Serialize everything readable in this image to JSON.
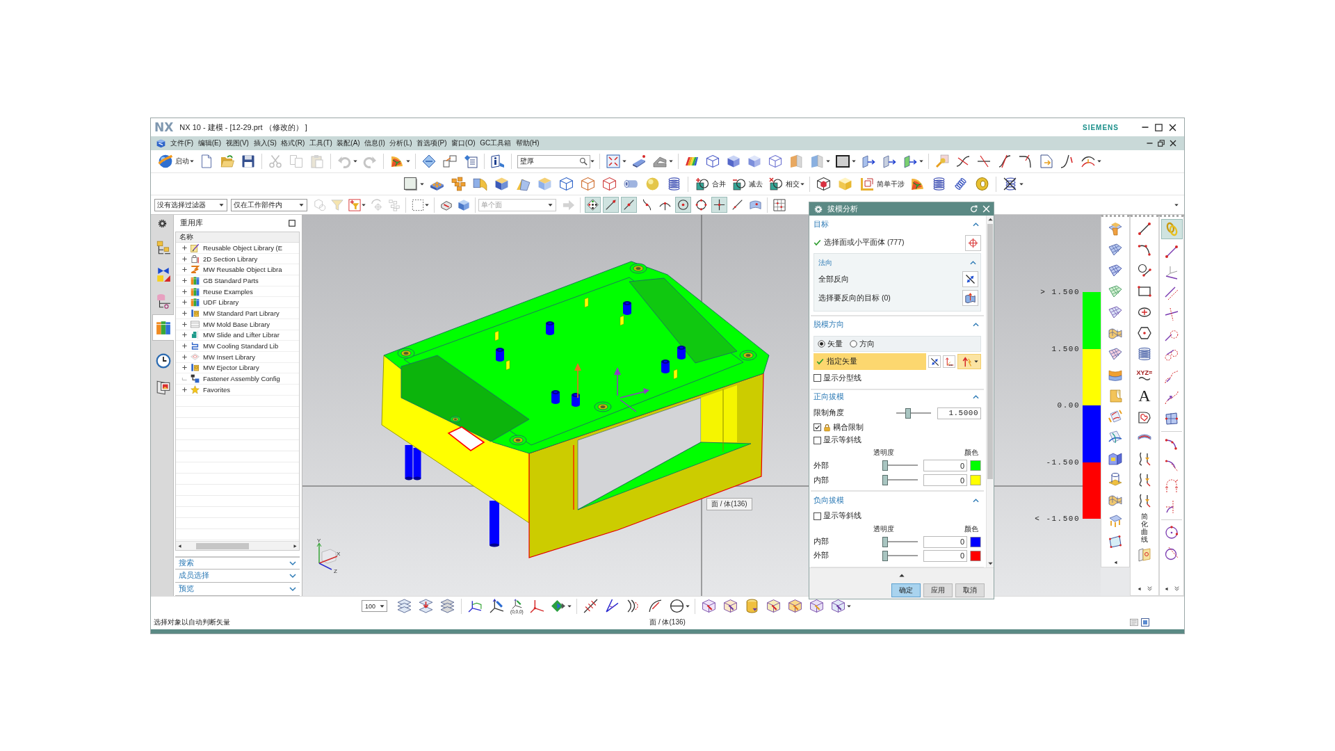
{
  "title_bar": {
    "logo": "NX",
    "title": "NX 10 - 建模 - [12-29.prt （修改的） ]",
    "brand": "SIEMENS"
  },
  "menu_bar": {
    "items": [
      "文件(F)",
      "编辑(E)",
      "视图(V)",
      "插入(S)",
      "格式(R)",
      "工具(T)",
      "装配(A)",
      "信息(I)",
      "分析(L)",
      "首选项(P)",
      "窗口(O)",
      "GC工具箱",
      "帮助(H)"
    ]
  },
  "standard_toolbar": {
    "start_button": "启动",
    "edit_tools": [
      {
        "disabled": true
      },
      {
        "disabled": true
      },
      {
        "disabled": true
      },
      {
        "disabled": true
      },
      {
        "disabled": true
      }
    ],
    "search": {
      "value": "壁厚"
    }
  },
  "feature_toolbar": {
    "labeled_buttons": [
      "合并",
      "减去",
      "相交",
      "简单干涉"
    ]
  },
  "selection_bar": {
    "type_filter": "没有选择过滤器",
    "scope": "仅在工作部件内",
    "tools": [
      {
        "disabled": true
      },
      {
        "disabled": true
      },
      {
        "disabled": false
      },
      {
        "disabled": true
      },
      {
        "disabled": true
      }
    ],
    "face_rule": {
      "value": "单个面",
      "disabled": true
    },
    "snap_points": [
      {
        "on": true
      },
      {
        "on": true
      },
      {
        "on": true
      },
      {
        "on": false
      },
      {
        "on": false
      },
      {
        "on": true
      },
      {
        "on": false
      },
      {
        "on": true
      },
      {
        "on": false
      },
      {
        "on": false
      }
    ]
  },
  "resource_bar": {
    "tabs": [
      {
        "selected": false
      },
      {
        "selected": false
      },
      {
        "selected": false
      },
      {
        "selected": true
      },
      {
        "selected": false
      },
      {
        "selected": false
      }
    ]
  },
  "reuse_library": {
    "title": "重用库",
    "column": "名称",
    "items": [
      {
        "label": "Reusable Object Library (E",
        "expandable": true
      },
      {
        "label": "2D Section Library",
        "expandable": true
      },
      {
        "label": "MW Reusable Object Libra",
        "expandable": true
      },
      {
        "label": "GB Standard Parts",
        "expandable": true
      },
      {
        "label": "Reuse Examples",
        "expandable": true
      },
      {
        "label": "UDF Library",
        "expandable": true
      },
      {
        "label": "MW Standard Part Library",
        "expandable": true
      },
      {
        "label": "MW Mold Base Library",
        "expandable": true
      },
      {
        "label": "MW Slide and Lifter Librar",
        "expandable": true
      },
      {
        "label": "MW Cooling Standard Lib",
        "expandable": true
      },
      {
        "label": "MW Insert Library",
        "expandable": true
      },
      {
        "label": "MW Ejector Library",
        "expandable": true
      },
      {
        "label": "Fastener Assembly Config",
        "expandable": false
      },
      {
        "label": "Favorites",
        "expandable": true
      }
    ],
    "sections": [
      {
        "label": "搜索",
        "expanded": false
      },
      {
        "label": "成员选择",
        "expanded": false
      },
      {
        "label": "预览",
        "expanded": false
      }
    ]
  },
  "viewport": {
    "tooltip": "面 / 体(136)",
    "axis_labels": [
      "Y",
      "X",
      "Z"
    ],
    "legend": {
      "labels": [
        "> 1.500",
        "1.500",
        "0.00",
        "-1.500",
        "< -1.500"
      ],
      "bands": [
        {
          "color": "#00ff00"
        },
        {
          "color": "#ffff00"
        },
        {
          "color": "#0000ff"
        },
        {
          "color": "#ff0000"
        }
      ]
    }
  },
  "draft_dialog": {
    "title": "拔模分析",
    "target": {
      "title": "目标",
      "expanded": true,
      "selection": {
        "label": "选择面或小平面体 (777)",
        "done": true
      },
      "normal": {
        "title": "法向",
        "expanded": true,
        "actions": [
          "全部反向",
          "选择要反向的目标 (0)"
        ]
      }
    },
    "draw_direction": {
      "title": "脱模方向",
      "expanded": true,
      "options": [
        {
          "label": "矢量",
          "selected": true
        },
        {
          "label": "方向",
          "selected": false
        }
      ],
      "vector": {
        "label": "指定矢量",
        "done": true
      },
      "parting_line": {
        "label": "显示分型线",
        "checked": false
      }
    },
    "positive_draft": {
      "title": "正向拔模",
      "expanded": true,
      "limit_angle": {
        "label": "限制角度",
        "level": 0.32,
        "value": "1.5000"
      },
      "coupled_limit": {
        "label": "耦合限制",
        "checked": true
      },
      "isoclines": {
        "label": "显示等斜线",
        "checked": false
      },
      "columns": [
        "透明度",
        "颜色"
      ],
      "rows": [
        {
          "label": "外部",
          "level": 0,
          "value": "0",
          "color": "#00ff00"
        },
        {
          "label": "内部",
          "level": 0,
          "value": "0",
          "color": "#ffff00"
        }
      ]
    },
    "negative_draft": {
      "title": "负向拔模",
      "expanded": true,
      "isoclines": {
        "label": "显示等斜线",
        "checked": false
      },
      "columns": [
        "透明度",
        "颜色"
      ],
      "rows": [
        {
          "label": "内部",
          "level": 0,
          "value": "0",
          "color": "#0000ff"
        },
        {
          "label": "外部",
          "level": 0,
          "value": "0",
          "color": "#ff0000"
        }
      ]
    },
    "buttons": [
      {
        "label": "确定",
        "default": true
      },
      {
        "label": "应用",
        "default": false
      },
      {
        "label": "取消",
        "default": false
      }
    ]
  },
  "side_toolbars": {
    "formula_label": "XYZ=",
    "text_label": "A",
    "vertical_label": "简化曲线",
    "chain_tool": {
      "on": true
    }
  },
  "view_toolbar": {
    "zoom": "100",
    "origin_label": "(0,0,0)"
  },
  "status_bar": {
    "prompt": "选择对象以自动判断矢量",
    "selection": "面 / 体(136)"
  }
}
